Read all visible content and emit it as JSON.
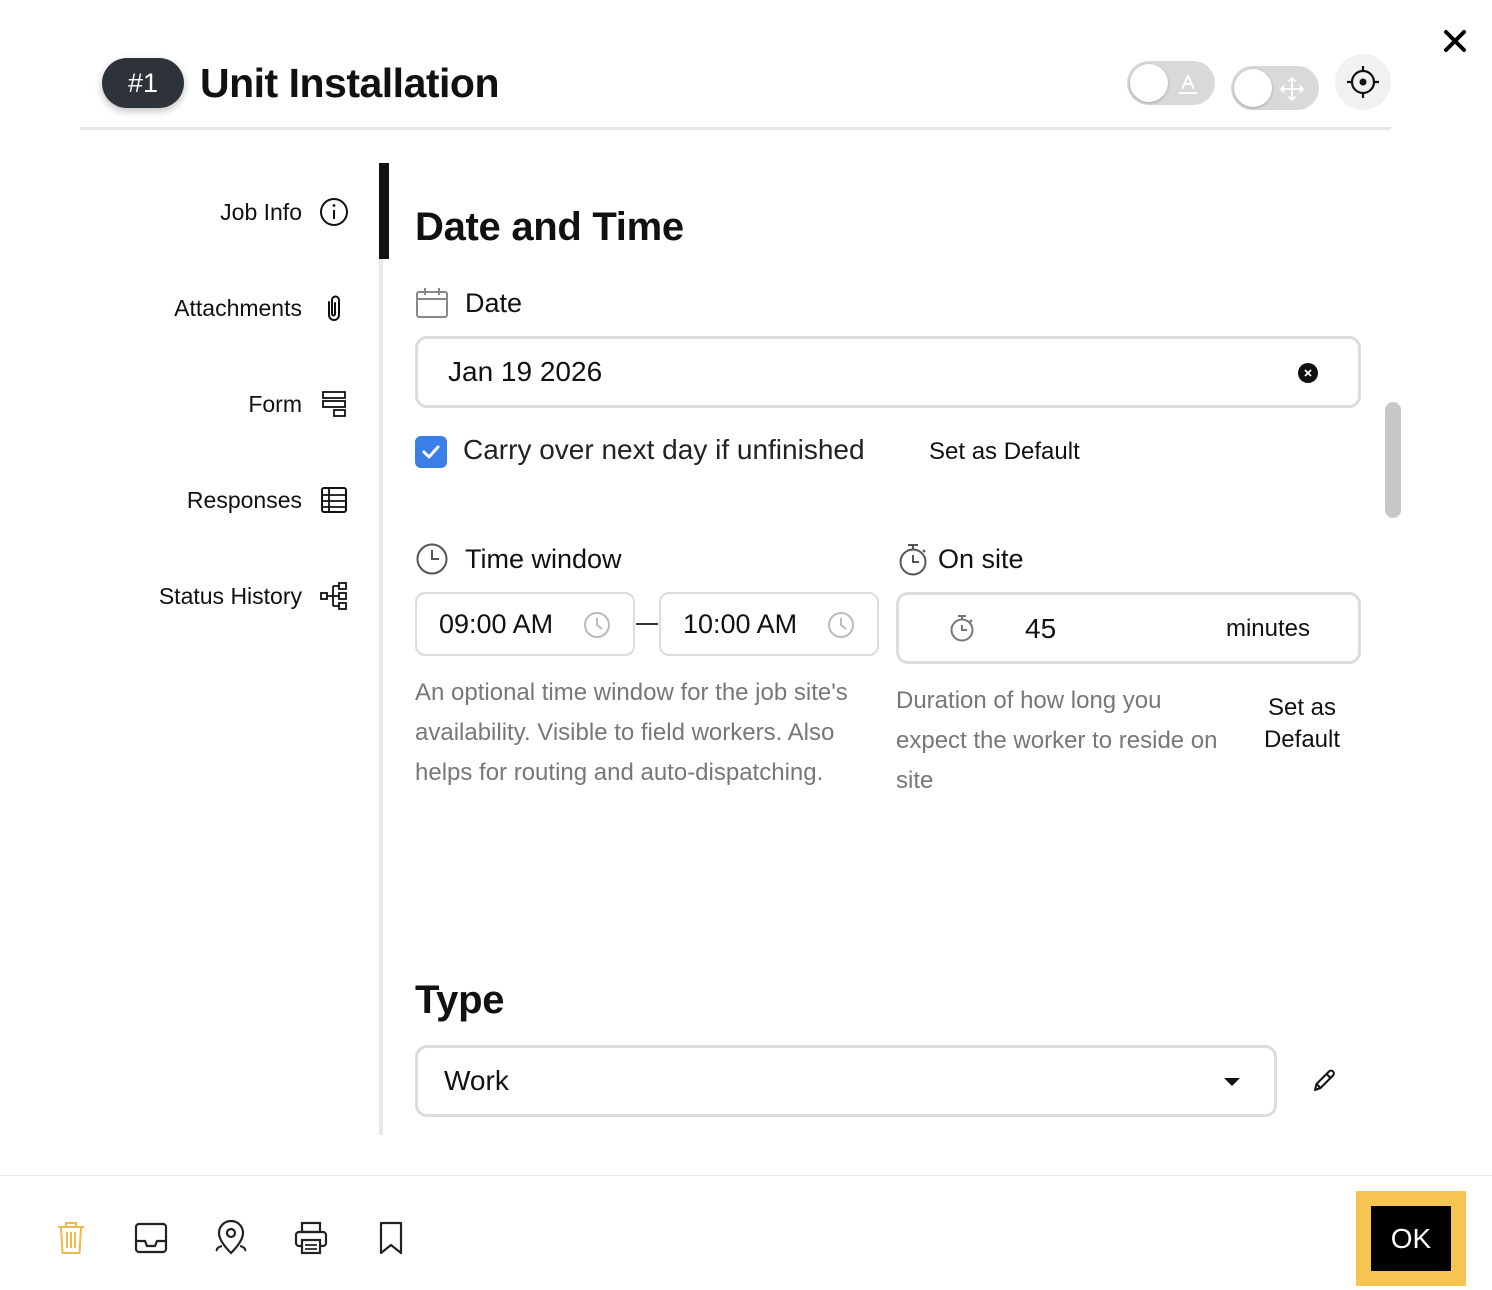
{
  "header": {
    "job_number": "#1",
    "title": "Unit Installation"
  },
  "sidebar": {
    "items": [
      {
        "label": "Job Info",
        "icon": "info-icon"
      },
      {
        "label": "Attachments",
        "icon": "paperclip-icon"
      },
      {
        "label": "Form",
        "icon": "form-icon"
      },
      {
        "label": "Responses",
        "icon": "table-icon"
      },
      {
        "label": "Status History",
        "icon": "tree-icon"
      }
    ],
    "active_index": 0
  },
  "date_time": {
    "section_title": "Date and Time",
    "date_label": "Date",
    "date_value": "Jan 19 2026",
    "carry_over_label": "Carry over next day if unfinished",
    "carry_over_checked": true,
    "set_default_label": "Set as Default",
    "time_window_label": "Time window",
    "time_start": "09:00 AM",
    "time_end": "10:00 AM",
    "time_window_help": "An optional time window for the job site's availability. Visible to field workers. Also helps for routing and auto-dispatching.",
    "on_site_label": "On site",
    "on_site_value": "45",
    "on_site_unit": "minutes",
    "on_site_help": "Duration of how long you expect the worker to reside on site",
    "on_site_set_default": "Set as Default"
  },
  "type_section": {
    "title": "Type",
    "selected": "Work"
  },
  "footer": {
    "icons": [
      "trash-icon",
      "inbox-icon",
      "map-pin-icon",
      "print-icon",
      "bookmark-icon"
    ],
    "ok_label": "OK"
  },
  "colors": {
    "accent": "#3b7ee8",
    "ok_highlight": "#f5c451",
    "trash": "#f0b94a",
    "badge": "#2d3338"
  }
}
